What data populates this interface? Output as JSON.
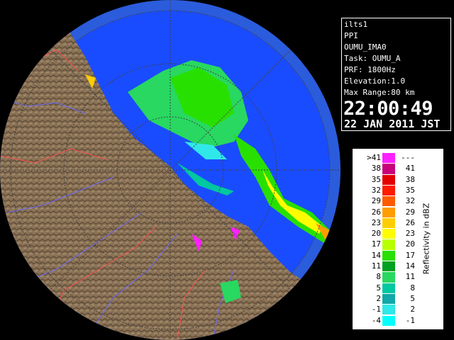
{
  "info": {
    "site": "ilts1",
    "mode": "PPI",
    "product": "OUMU_IMA0",
    "task": "Task: OUMU_A",
    "prf": "PRF: 1800Hz",
    "elevation": "Elevation:1.0",
    "max_range": "Max Range:80 km",
    "time": "22:00:49",
    "date": "22 JAN 2011 JST"
  },
  "legend": {
    "unit_label": "Reflectivity in dBZ",
    "rows": [
      {
        "lo": ">41",
        "hi": "---",
        "color": "#ff20ff"
      },
      {
        "lo": "38",
        "hi": "41",
        "color": "#c8007a"
      },
      {
        "lo": "35",
        "hi": "38",
        "color": "#e30000"
      },
      {
        "lo": "32",
        "hi": "35",
        "color": "#ff1a00"
      },
      {
        "lo": "29",
        "hi": "32",
        "color": "#ff5a00"
      },
      {
        "lo": "26",
        "hi": "29",
        "color": "#ff9c00"
      },
      {
        "lo": "23",
        "hi": "26",
        "color": "#ffce00"
      },
      {
        "lo": "20",
        "hi": "23",
        "color": "#fffc00"
      },
      {
        "lo": "17",
        "hi": "20",
        "color": "#b8ff00"
      },
      {
        "lo": "14",
        "hi": "17",
        "color": "#28e000"
      },
      {
        "lo": "11",
        "hi": "14",
        "color": "#00a020"
      },
      {
        "lo": "8",
        "hi": "11",
        "color": "#28d860"
      },
      {
        "lo": "5",
        "hi": "8",
        "color": "#00c8a0"
      },
      {
        "lo": "2",
        "hi": "5",
        "color": "#10a8a8"
      },
      {
        "lo": "-1",
        "hi": "2",
        "color": "#30e8e8"
      },
      {
        "lo": "-4",
        "hi": "-1",
        "color": "#00ffff"
      }
    ]
  },
  "map": {
    "sea_color": "#1a4cff",
    "outer_sea_color": "#2b5cdc",
    "land_color": "#8a7256"
  }
}
